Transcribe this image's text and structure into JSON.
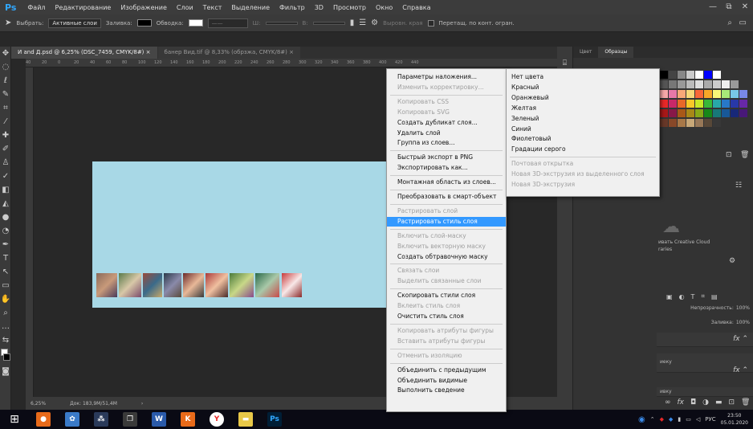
{
  "menubar": {
    "logo": "Ps",
    "items": [
      "Файл",
      "Редактирование",
      "Изображение",
      "Слои",
      "Текст",
      "Выделение",
      "Фильтр",
      "3D",
      "Просмотр",
      "Окно",
      "Справка"
    ]
  },
  "window_controls": {
    "minimize": "—",
    "restore": "⧉",
    "close": "✕"
  },
  "options_bar": {
    "select_label": "Выбрать:",
    "select_value": "Активные слои",
    "fill_label": "Заливка:",
    "stroke_label": "Обводка:",
    "w_label": "Ш:",
    "h_label": "В:",
    "align_edges": "Выровн. края",
    "drag_label": "Перетащ. по конт. огран."
  },
  "tabs": [
    {
      "label": "И and Д.psd @ 6,25% (DSC_7459, CMYK/8#) ×",
      "active": true
    },
    {
      "label": "банер Вид.tif @ 8,33% (обрзжа, CMYK/8#) ×",
      "active": false
    }
  ],
  "ruler_top": [
    "40",
    "20",
    "0",
    "20",
    "40",
    "60",
    "80",
    "100",
    "120",
    "140",
    "160",
    "180",
    "200",
    "220",
    "240",
    "260",
    "280",
    "300",
    "320",
    "340",
    "360",
    "380",
    "400",
    "420",
    "440"
  ],
  "status": {
    "zoom": "6,25%",
    "doc": "Док: 183,9M/51,4M"
  },
  "panel": {
    "tabs": [
      "Цвет",
      "Образцы"
    ],
    "cc_text": "ивать Creative Cloud",
    "cc_text2": "raries",
    "opacity_label": "Непрозрачность:",
    "opacity_value": "100%",
    "fill_label": "Заливка:",
    "fill_value": "100%",
    "layer_name_1": "иеку",
    "layer_name_2": "ивку"
  },
  "context_menu": {
    "items": [
      {
        "label": "Параметры наложения...",
        "enabled": true
      },
      {
        "label": "Изменить корректировку...",
        "enabled": false
      },
      {
        "sep": true
      },
      {
        "label": "Копировать CSS",
        "enabled": false
      },
      {
        "label": "Копировать SVG",
        "enabled": false
      },
      {
        "label": "Создать дубликат слоя...",
        "enabled": true
      },
      {
        "label": "Удалить слой",
        "enabled": true
      },
      {
        "label": "Группа из слоев...",
        "enabled": true
      },
      {
        "sep": true
      },
      {
        "label": "Быстрый экспорт в PNG",
        "enabled": true
      },
      {
        "label": "Экспортировать как...",
        "enabled": true
      },
      {
        "sep": true
      },
      {
        "label": "Монтажная область из слоев...",
        "enabled": true
      },
      {
        "sep": true
      },
      {
        "label": "Преобразовать в смарт-объект",
        "enabled": true
      },
      {
        "sep": true
      },
      {
        "label": "Растрировать слой",
        "enabled": false
      },
      {
        "label": "Растрировать стиль слоя",
        "enabled": true,
        "highlighted": true
      },
      {
        "sep": true
      },
      {
        "label": "Включить слой-маску",
        "enabled": false
      },
      {
        "label": "Включить векторную маску",
        "enabled": false
      },
      {
        "label": "Создать обтравочную маску",
        "enabled": true
      },
      {
        "sep": true
      },
      {
        "label": "Связать слои",
        "enabled": false
      },
      {
        "label": "Выделить связанные слои",
        "enabled": false
      },
      {
        "sep": true
      },
      {
        "label": "Скопировать стили слоя",
        "enabled": true
      },
      {
        "label": "Вклеить стиль слоя",
        "enabled": false
      },
      {
        "label": "Очистить стиль слоя",
        "enabled": true
      },
      {
        "sep": true
      },
      {
        "label": "Копировать атрибуты фигуры",
        "enabled": false
      },
      {
        "label": "Вставить атрибуты фигуры",
        "enabled": false
      },
      {
        "sep": true
      },
      {
        "label": "Отменить изоляцию",
        "enabled": false
      },
      {
        "sep": true
      },
      {
        "label": "Объединить с предыдущим",
        "enabled": true
      },
      {
        "label": "Объединить видимые",
        "enabled": true
      },
      {
        "label": "Выполнить сведение",
        "enabled": true
      }
    ]
  },
  "submenu": {
    "items": [
      {
        "label": "Нет цвета",
        "enabled": true
      },
      {
        "label": "Красный",
        "enabled": true
      },
      {
        "label": "Оранжевый",
        "enabled": true
      },
      {
        "label": "Желтая",
        "enabled": true
      },
      {
        "label": "Зеленый",
        "enabled": true
      },
      {
        "label": "Синий",
        "enabled": true
      },
      {
        "label": "Фиолетовый",
        "enabled": true
      },
      {
        "label": "Градации серого",
        "enabled": true
      },
      {
        "sep": true
      },
      {
        "label": "Почтовая открытка",
        "enabled": false
      },
      {
        "label": "Новая 3D-экструзия из выделенного слоя",
        "enabled": false
      },
      {
        "label": "Новая 3D-экструзия",
        "enabled": false
      }
    ]
  },
  "taskbar": {
    "start_icon": "windows-logo",
    "tray_lang": "РУС",
    "clock_time": "23:50",
    "clock_date": "05.01.2020"
  },
  "colors": {
    "accent": "#3399ff",
    "ps_blue": "#31a8ff",
    "canvas_bg": "#a8d8e6"
  }
}
